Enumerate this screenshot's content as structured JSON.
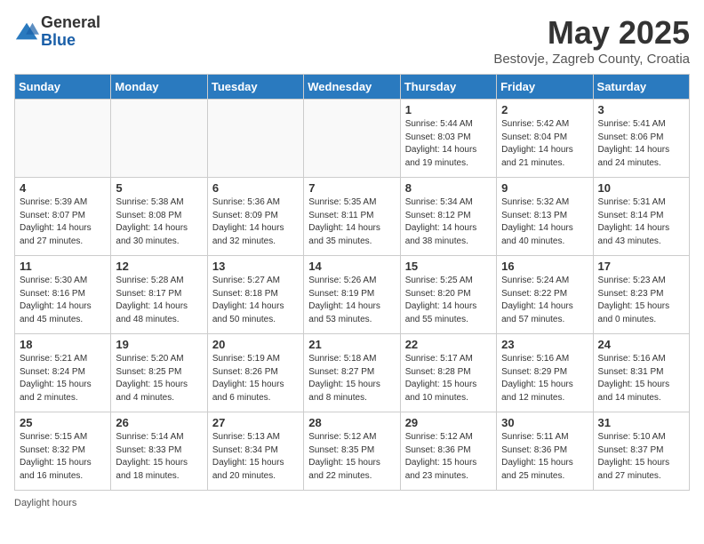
{
  "header": {
    "logo_general": "General",
    "logo_blue": "Blue",
    "month_title": "May 2025",
    "location": "Bestovje, Zagreb County, Croatia"
  },
  "days_of_week": [
    "Sunday",
    "Monday",
    "Tuesday",
    "Wednesday",
    "Thursday",
    "Friday",
    "Saturday"
  ],
  "weeks": [
    [
      {
        "day": "",
        "info": ""
      },
      {
        "day": "",
        "info": ""
      },
      {
        "day": "",
        "info": ""
      },
      {
        "day": "",
        "info": ""
      },
      {
        "day": "1",
        "info": "Sunrise: 5:44 AM\nSunset: 8:03 PM\nDaylight: 14 hours\nand 19 minutes."
      },
      {
        "day": "2",
        "info": "Sunrise: 5:42 AM\nSunset: 8:04 PM\nDaylight: 14 hours\nand 21 minutes."
      },
      {
        "day": "3",
        "info": "Sunrise: 5:41 AM\nSunset: 8:06 PM\nDaylight: 14 hours\nand 24 minutes."
      }
    ],
    [
      {
        "day": "4",
        "info": "Sunrise: 5:39 AM\nSunset: 8:07 PM\nDaylight: 14 hours\nand 27 minutes."
      },
      {
        "day": "5",
        "info": "Sunrise: 5:38 AM\nSunset: 8:08 PM\nDaylight: 14 hours\nand 30 minutes."
      },
      {
        "day": "6",
        "info": "Sunrise: 5:36 AM\nSunset: 8:09 PM\nDaylight: 14 hours\nand 32 minutes."
      },
      {
        "day": "7",
        "info": "Sunrise: 5:35 AM\nSunset: 8:11 PM\nDaylight: 14 hours\nand 35 minutes."
      },
      {
        "day": "8",
        "info": "Sunrise: 5:34 AM\nSunset: 8:12 PM\nDaylight: 14 hours\nand 38 minutes."
      },
      {
        "day": "9",
        "info": "Sunrise: 5:32 AM\nSunset: 8:13 PM\nDaylight: 14 hours\nand 40 minutes."
      },
      {
        "day": "10",
        "info": "Sunrise: 5:31 AM\nSunset: 8:14 PM\nDaylight: 14 hours\nand 43 minutes."
      }
    ],
    [
      {
        "day": "11",
        "info": "Sunrise: 5:30 AM\nSunset: 8:16 PM\nDaylight: 14 hours\nand 45 minutes."
      },
      {
        "day": "12",
        "info": "Sunrise: 5:28 AM\nSunset: 8:17 PM\nDaylight: 14 hours\nand 48 minutes."
      },
      {
        "day": "13",
        "info": "Sunrise: 5:27 AM\nSunset: 8:18 PM\nDaylight: 14 hours\nand 50 minutes."
      },
      {
        "day": "14",
        "info": "Sunrise: 5:26 AM\nSunset: 8:19 PM\nDaylight: 14 hours\nand 53 minutes."
      },
      {
        "day": "15",
        "info": "Sunrise: 5:25 AM\nSunset: 8:20 PM\nDaylight: 14 hours\nand 55 minutes."
      },
      {
        "day": "16",
        "info": "Sunrise: 5:24 AM\nSunset: 8:22 PM\nDaylight: 14 hours\nand 57 minutes."
      },
      {
        "day": "17",
        "info": "Sunrise: 5:23 AM\nSunset: 8:23 PM\nDaylight: 15 hours\nand 0 minutes."
      }
    ],
    [
      {
        "day": "18",
        "info": "Sunrise: 5:21 AM\nSunset: 8:24 PM\nDaylight: 15 hours\nand 2 minutes."
      },
      {
        "day": "19",
        "info": "Sunrise: 5:20 AM\nSunset: 8:25 PM\nDaylight: 15 hours\nand 4 minutes."
      },
      {
        "day": "20",
        "info": "Sunrise: 5:19 AM\nSunset: 8:26 PM\nDaylight: 15 hours\nand 6 minutes."
      },
      {
        "day": "21",
        "info": "Sunrise: 5:18 AM\nSunset: 8:27 PM\nDaylight: 15 hours\nand 8 minutes."
      },
      {
        "day": "22",
        "info": "Sunrise: 5:17 AM\nSunset: 8:28 PM\nDaylight: 15 hours\nand 10 minutes."
      },
      {
        "day": "23",
        "info": "Sunrise: 5:16 AM\nSunset: 8:29 PM\nDaylight: 15 hours\nand 12 minutes."
      },
      {
        "day": "24",
        "info": "Sunrise: 5:16 AM\nSunset: 8:31 PM\nDaylight: 15 hours\nand 14 minutes."
      }
    ],
    [
      {
        "day": "25",
        "info": "Sunrise: 5:15 AM\nSunset: 8:32 PM\nDaylight: 15 hours\nand 16 minutes."
      },
      {
        "day": "26",
        "info": "Sunrise: 5:14 AM\nSunset: 8:33 PM\nDaylight: 15 hours\nand 18 minutes."
      },
      {
        "day": "27",
        "info": "Sunrise: 5:13 AM\nSunset: 8:34 PM\nDaylight: 15 hours\nand 20 minutes."
      },
      {
        "day": "28",
        "info": "Sunrise: 5:12 AM\nSunset: 8:35 PM\nDaylight: 15 hours\nand 22 minutes."
      },
      {
        "day": "29",
        "info": "Sunrise: 5:12 AM\nSunset: 8:36 PM\nDaylight: 15 hours\nand 23 minutes."
      },
      {
        "day": "30",
        "info": "Sunrise: 5:11 AM\nSunset: 8:36 PM\nDaylight: 15 hours\nand 25 minutes."
      },
      {
        "day": "31",
        "info": "Sunrise: 5:10 AM\nSunset: 8:37 PM\nDaylight: 15 hours\nand 27 minutes."
      }
    ]
  ],
  "footer": {
    "daylight_hours_label": "Daylight hours"
  }
}
